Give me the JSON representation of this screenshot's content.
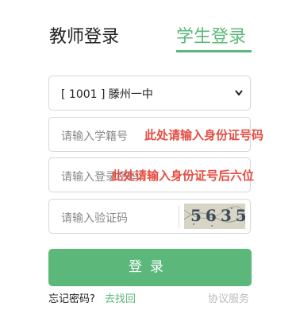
{
  "tabs": {
    "teacher_label": "教师登录",
    "student_label": "学生登录"
  },
  "school_select": {
    "selected": "[ 1001 ] 滕州一中"
  },
  "id_field": {
    "placeholder": "请输入学籍号",
    "hint": "此处请输入身份证号码"
  },
  "password_field": {
    "placeholder": "请输入登录密码",
    "hint": "此处请输入身份证号后六位"
  },
  "captcha": {
    "placeholder": "请输入验证码",
    "image_text": "5635"
  },
  "login_button": "登录",
  "footer": {
    "forgot": "忘记密码?",
    "find": "去找回",
    "agreement": "协议服务"
  },
  "colors": {
    "accent": "#5cb87a",
    "hint": "#e54d42"
  }
}
